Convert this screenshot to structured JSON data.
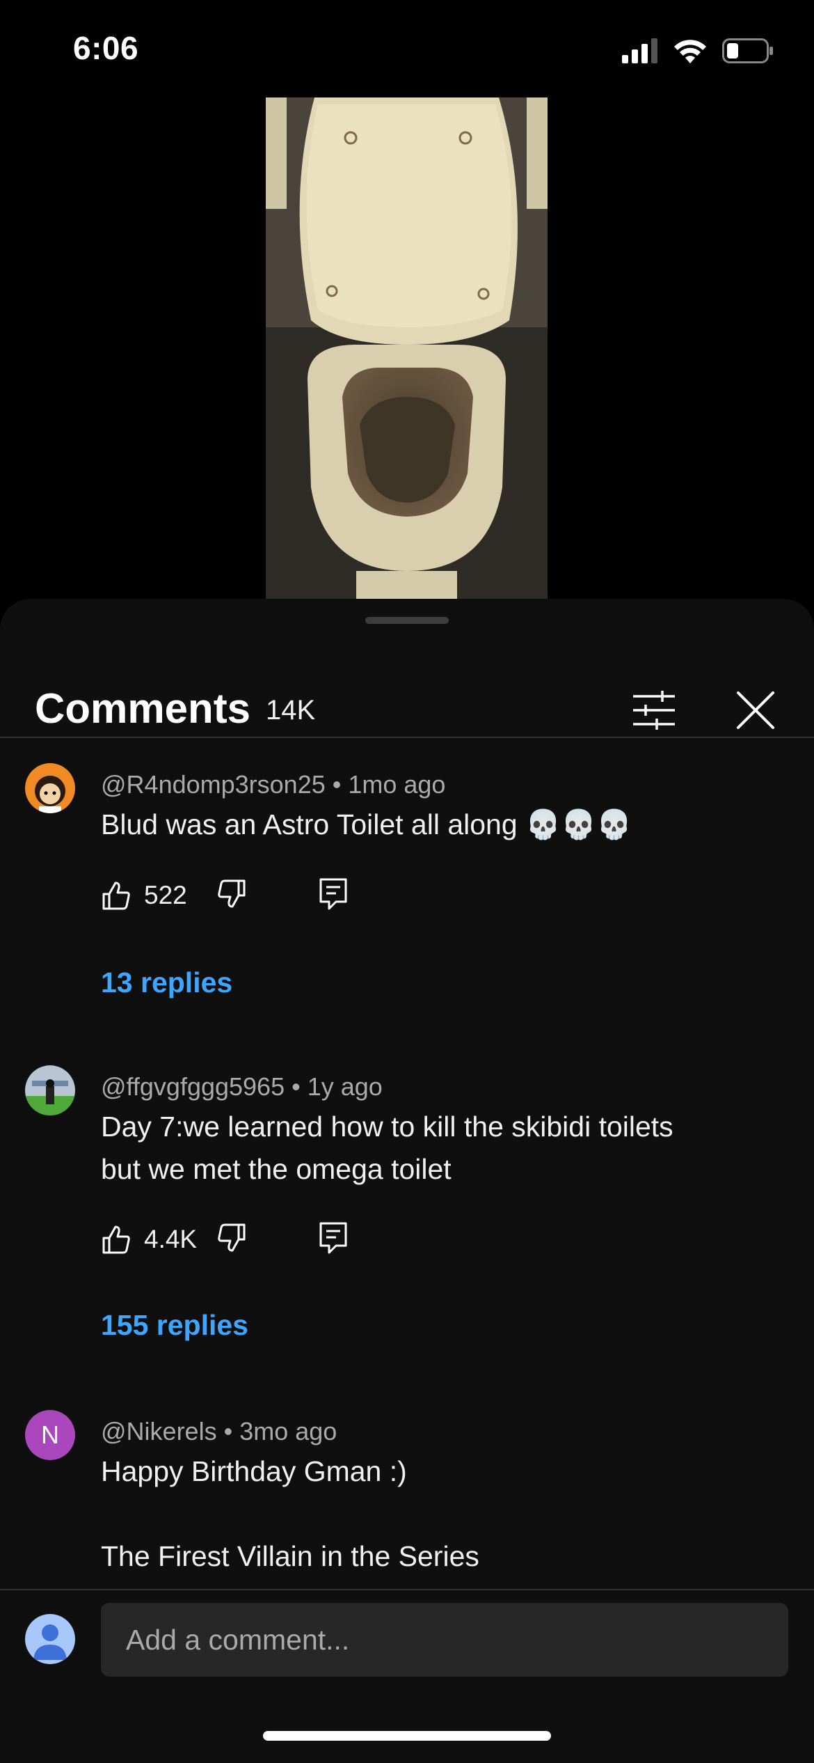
{
  "status_bar": {
    "time": "6:06"
  },
  "comments_panel": {
    "title": "Comments",
    "count": "14K",
    "comments": [
      {
        "author": "@R4ndomp3rson25",
        "time": "1mo ago",
        "text": "Blud was an Astro Toilet all along 💀💀💀",
        "likes": "522",
        "replies": "13 replies"
      },
      {
        "author": "@ffgvgfggg5965",
        "time": "1y ago",
        "text_lines": [
          "Day 7:we learned how to kill the skibidi toilets",
          "but we met the omega toilet"
        ],
        "likes": "4.4K",
        "replies": "155 replies"
      },
      {
        "author": "@Nikerels",
        "time": "3mo ago",
        "avatar_letter": "N",
        "avatar_color": "#ab47bc",
        "text_lines": [
          "Happy Birthday Gman :)",
          "",
          "The Firest Villain in the Series"
        ]
      }
    ],
    "compose": {
      "placeholder": "Add a comment..."
    }
  },
  "colors": {
    "link": "#3ea6ff",
    "background": "#0f0f0f",
    "muted": "#aaaaaa"
  }
}
